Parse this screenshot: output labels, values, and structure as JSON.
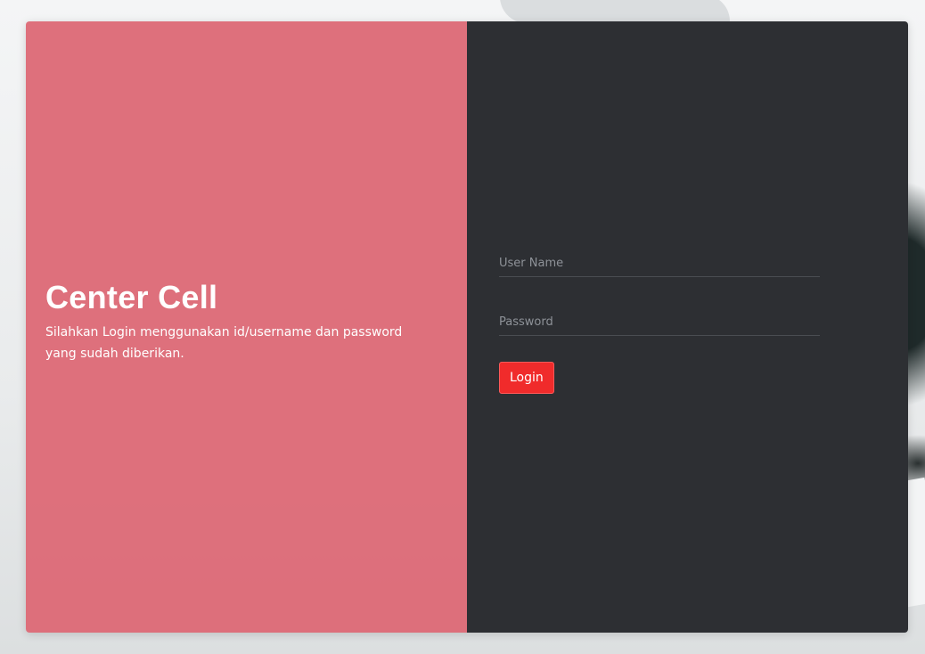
{
  "brand": {
    "title": "Center Cell",
    "subtitle": "Silahkan Login menggunakan id/username dan password yang sudah diberikan."
  },
  "form": {
    "username_placeholder": "User Name",
    "username_value": "",
    "password_placeholder": "Password",
    "password_value": "",
    "login_label": "Login"
  },
  "colors": {
    "left_panel": "#dd6b78",
    "right_panel": "#2d2f33",
    "login_button": "#f02b2b"
  }
}
